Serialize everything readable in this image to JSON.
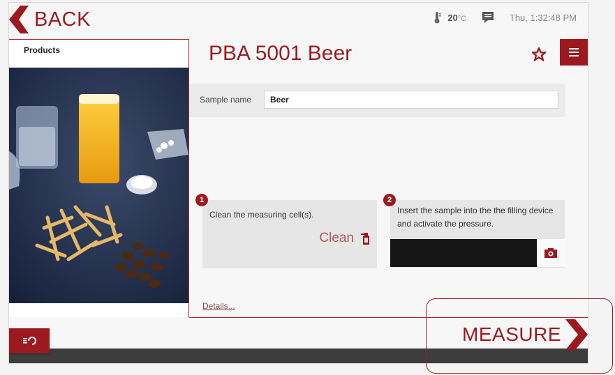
{
  "topbar": {
    "back_label": "BACK",
    "temperature_value": "20",
    "temperature_unit": "°C",
    "datetime": "Thu, 1:32:48 PM"
  },
  "panel": {
    "title": "Products"
  },
  "main": {
    "title": "PBA 5001 Beer",
    "sample_label": "Sample name",
    "sample_value": "Beer",
    "steps": [
      {
        "number": "1",
        "text": "Clean the measuring cell(s).",
        "action_label": "Clean"
      },
      {
        "number": "2",
        "text": "Insert the sample into the the filling device and activate the pressure."
      }
    ],
    "details_link": "Details..."
  },
  "footer": {
    "measure_label": "MEASURE"
  },
  "colors": {
    "accent": "#9c1a1f",
    "background": "#f7f7f7",
    "step_panel": "#e6e6e6"
  },
  "icons": [
    "back-chevron-icon",
    "thermometer-icon",
    "messages-icon",
    "star-icon",
    "menu-icon",
    "clean-bottle-icon",
    "camera-icon",
    "reset-hand-icon",
    "forward-chevron-icon"
  ]
}
